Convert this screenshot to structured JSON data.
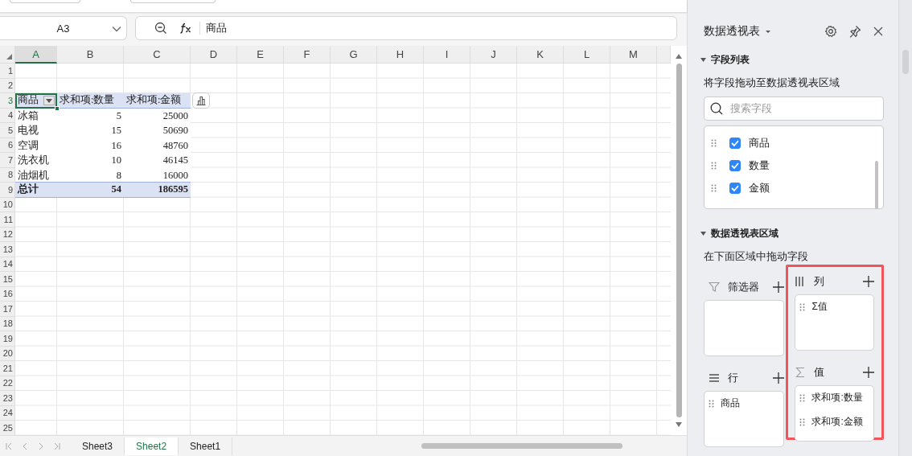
{
  "name_box": {
    "value": "A3"
  },
  "formula_bar": {
    "value": "商品"
  },
  "columns": [
    {
      "label": "A",
      "selected": true
    },
    {
      "label": "B",
      "selected": false
    },
    {
      "label": "C",
      "selected": false
    },
    {
      "label": "D",
      "selected": false
    },
    {
      "label": "E",
      "selected": false
    },
    {
      "label": "F",
      "selected": false
    },
    {
      "label": "G",
      "selected": false
    },
    {
      "label": "H",
      "selected": false
    },
    {
      "label": "I",
      "selected": false
    },
    {
      "label": "J",
      "selected": false
    },
    {
      "label": "K",
      "selected": false
    },
    {
      "label": "L",
      "selected": false
    },
    {
      "label": "M",
      "selected": false
    }
  ],
  "rows": [
    {
      "number": "1",
      "selected": false,
      "kind": "empty"
    },
    {
      "number": "2",
      "selected": false,
      "kind": "empty"
    },
    {
      "number": "3",
      "selected": true,
      "kind": "pivot_header",
      "cells": [
        "商品",
        "求和项:数量",
        "求和项:金额"
      ]
    },
    {
      "number": "4",
      "selected": false,
      "kind": "pivot_body",
      "cells": [
        "冰箱",
        "5",
        "25000"
      ]
    },
    {
      "number": "5",
      "selected": false,
      "kind": "pivot_body",
      "cells": [
        "电视",
        "15",
        "50690"
      ]
    },
    {
      "number": "6",
      "selected": false,
      "kind": "pivot_body",
      "cells": [
        "空调",
        "16",
        "48760"
      ]
    },
    {
      "number": "7",
      "selected": false,
      "kind": "pivot_body",
      "cells": [
        "洗衣机",
        "10",
        "46145"
      ]
    },
    {
      "number": "8",
      "selected": false,
      "kind": "pivot_body",
      "cells": [
        "油烟机",
        "8",
        "16000"
      ]
    },
    {
      "number": "9",
      "selected": false,
      "kind": "pivot_total",
      "cells": [
        "总计",
        "54",
        "186595"
      ]
    },
    {
      "number": "10",
      "selected": false,
      "kind": "empty"
    },
    {
      "number": "11",
      "selected": false,
      "kind": "empty"
    },
    {
      "number": "12",
      "selected": false,
      "kind": "empty"
    },
    {
      "number": "13",
      "selected": false,
      "kind": "empty"
    },
    {
      "number": "14",
      "selected": false,
      "kind": "empty"
    },
    {
      "number": "15",
      "selected": false,
      "kind": "empty"
    },
    {
      "number": "16",
      "selected": false,
      "kind": "empty"
    },
    {
      "number": "17",
      "selected": false,
      "kind": "empty"
    },
    {
      "number": "18",
      "selected": false,
      "kind": "empty"
    },
    {
      "number": "19",
      "selected": false,
      "kind": "empty"
    },
    {
      "number": "20",
      "selected": false,
      "kind": "empty"
    },
    {
      "number": "21",
      "selected": false,
      "kind": "empty"
    },
    {
      "number": "22",
      "selected": false,
      "kind": "empty"
    },
    {
      "number": "23",
      "selected": false,
      "kind": "empty"
    },
    {
      "number": "24",
      "selected": false,
      "kind": "empty"
    },
    {
      "number": "25",
      "selected": false,
      "kind": "empty"
    }
  ],
  "sheet_tabs": [
    {
      "label": "Sheet3",
      "selected": false
    },
    {
      "label": "Sheet2",
      "selected": true
    },
    {
      "label": "Sheet1",
      "selected": false
    }
  ],
  "panel": {
    "title": "数据透视表",
    "field_list": {
      "title": "字段列表",
      "expanded": true,
      "hint": "将字段拖动至数据透视表区域",
      "search": {
        "placeholder": "搜索字段"
      },
      "fields": [
        {
          "name": "商品",
          "checked": true
        },
        {
          "name": "数量",
          "checked": true
        },
        {
          "name": "金额",
          "checked": true
        }
      ]
    },
    "areas_section": {
      "title": "数据透视表区域",
      "expanded": true,
      "hint": "在下面区域中拖动字段",
      "area_columns": [
        {
          "highlighted": false,
          "areas": [
            {
              "kind": "filter",
              "label": "筛选器"
            },
            {
              "kind": "rows",
              "label": "行",
              "items": [
                "商品"
              ]
            }
          ]
        },
        {
          "highlighted": true,
          "areas": [
            {
              "kind": "columns",
              "label": "列",
              "items": [
                "Σ值"
              ]
            },
            {
              "kind": "values",
              "label": "值",
              "items": [
                "求和项:数量",
                "求和项:金额"
              ]
            }
          ]
        }
      ]
    }
  }
}
